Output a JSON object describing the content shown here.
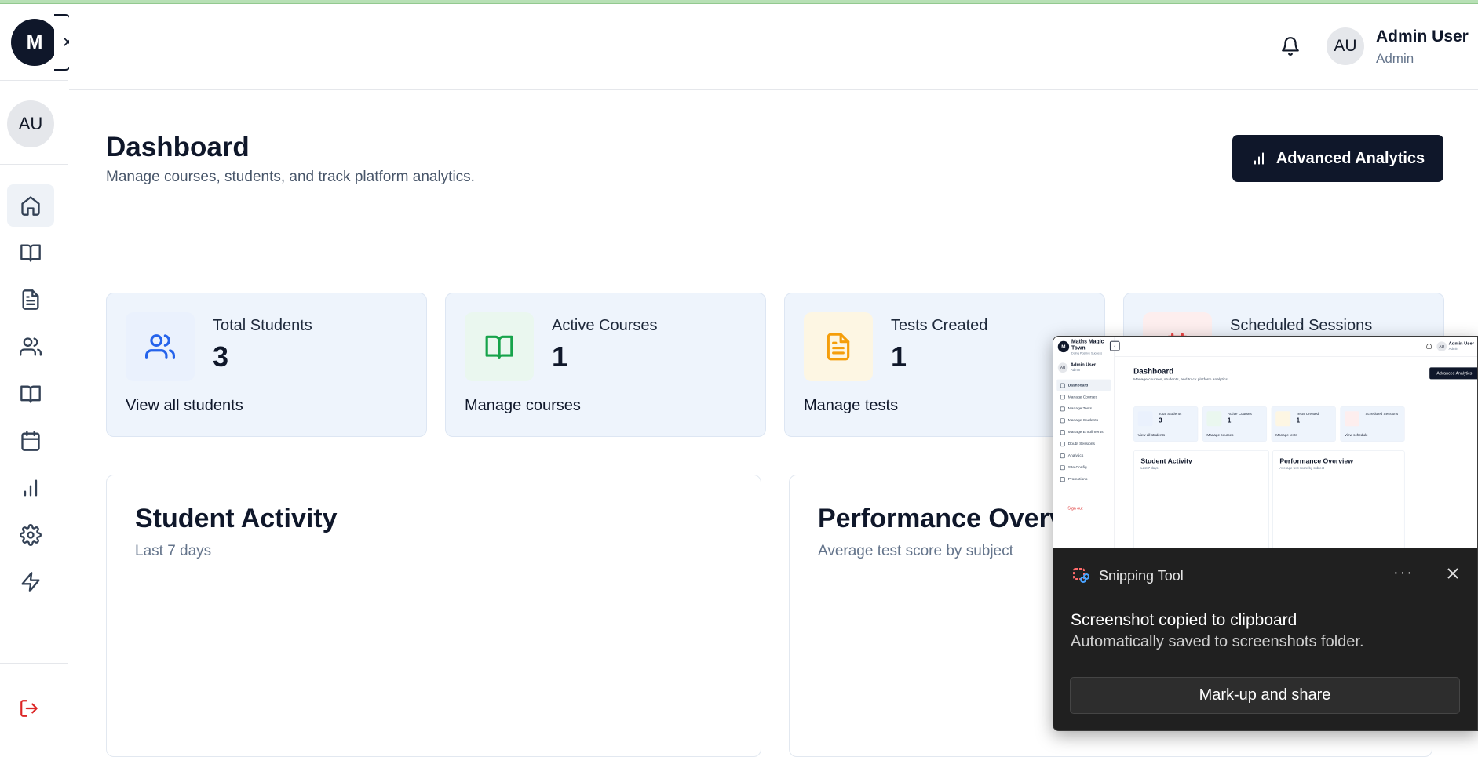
{
  "sidebar": {
    "logo_text": "M",
    "collapse_icon": "x-icon",
    "avatar_initials": "AU",
    "nav_icons": [
      "home-icon",
      "book-open-icon",
      "file-text-icon",
      "users-icon",
      "book-open-icon",
      "calendar-icon",
      "bar-chart-icon",
      "settings-icon",
      "zap-icon"
    ],
    "logout_icon": "log-out-icon"
  },
  "header": {
    "notification_icon": "bell-icon",
    "avatar_initials": "AU",
    "user_name": "Admin User",
    "user_role": "Admin"
  },
  "page": {
    "title": "Dashboard",
    "subtitle": "Manage courses, students, and track platform analytics.",
    "analytics_button": "Advanced Analytics"
  },
  "stats": [
    {
      "label": "Total Students",
      "value": "3",
      "link": "View all students",
      "icon": "users-icon",
      "color": "#2563eb"
    },
    {
      "label": "Active Courses",
      "value": "1",
      "link": "Manage courses",
      "icon": "book-open-icon",
      "color": "#16a34a"
    },
    {
      "label": "Tests Created",
      "value": "1",
      "link": "Manage tests",
      "icon": "file-text-icon",
      "color": "#f59e0b"
    },
    {
      "label": "Scheduled Sessions",
      "value": "",
      "link": "",
      "icon": "calendar-icon",
      "color": "#ef4444"
    }
  ],
  "panels": [
    {
      "title": "Student Activity",
      "subtitle": "Last 7 days"
    },
    {
      "title": "Performance Overview",
      "subtitle": "Average test score by subject"
    }
  ],
  "notification": {
    "app_name": "Snipping Tool",
    "message": "Screenshot copied to clipboard",
    "detail": "Automatically saved to screenshots folder.",
    "action_button": "Mark-up and share",
    "more_label": "···",
    "preview": {
      "brand": "Maths Magic Town",
      "brand_sub": "Doing Positive Success",
      "user_name": "Admin User",
      "user_role": "Admin",
      "initials": "AU",
      "nav": [
        "Dashboard",
        "Manage Courses",
        "Manage Tests",
        "Manage Students",
        "Manage Enrollments",
        "Doubt Sessions",
        "Analytics",
        "Site Config",
        "Promotions"
      ],
      "sign_out": "Sign out",
      "title": "Dashboard",
      "subtitle": "Manage courses, students, and track platform analytics.",
      "button": "Advanced Analytics",
      "cards": [
        {
          "label": "Total Students",
          "value": "3",
          "link": "View all students"
        },
        {
          "label": "Active Courses",
          "value": "1",
          "link": "Manage courses"
        },
        {
          "label": "Tests Created",
          "value": "1",
          "link": "Manage tests"
        },
        {
          "label": "Scheduled Sessions",
          "value": "",
          "link": "View schedule"
        }
      ],
      "panels": [
        {
          "title": "Student Activity",
          "subtitle": "Last 7 days"
        },
        {
          "title": "Performance Overview",
          "subtitle": "Average test score by subject"
        }
      ]
    }
  }
}
